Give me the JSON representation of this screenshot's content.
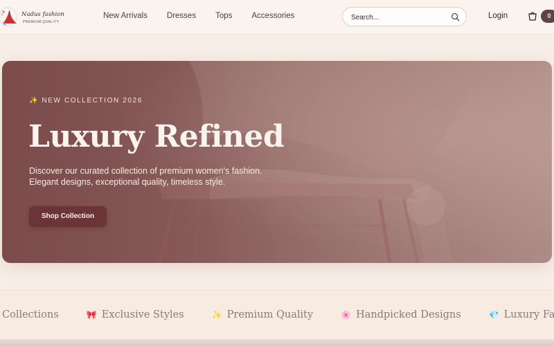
{
  "brand": {
    "name": "Nadus fashion",
    "tagline": "PREMIUM QUALITY"
  },
  "nav": [
    {
      "label": "New Arrivals"
    },
    {
      "label": "Dresses"
    },
    {
      "label": "Tops"
    },
    {
      "label": "Accessories"
    }
  ],
  "search": {
    "placeholder": "Search...",
    "icon": "search-icon"
  },
  "account": {
    "login_label": "Login"
  },
  "cart": {
    "icon": "shopping-bag-icon",
    "count": "0"
  },
  "hero": {
    "eyebrow": "✨ NEW COLLECTION 2026",
    "title": "Luxury Refined",
    "subtitle": "Discover our curated collection of premium women's fashion. Elegant designs, exceptional quality, timeless style.",
    "cta_label": "Shop Collection"
  },
  "ticker": {
    "items": [
      {
        "icon": "",
        "label": "Collections"
      },
      {
        "icon": "🎀",
        "label": "Exclusive Styles"
      },
      {
        "icon": "✨",
        "label": "Premium Quality"
      },
      {
        "icon": "🌸",
        "label": "Handpicked Designs"
      },
      {
        "icon": "💎",
        "label": "Luxury Fabrics"
      }
    ]
  },
  "colors": {
    "accent": "#6b3538",
    "hero_overlay": "#8a5f5d",
    "page_background": "#f7efe7"
  }
}
